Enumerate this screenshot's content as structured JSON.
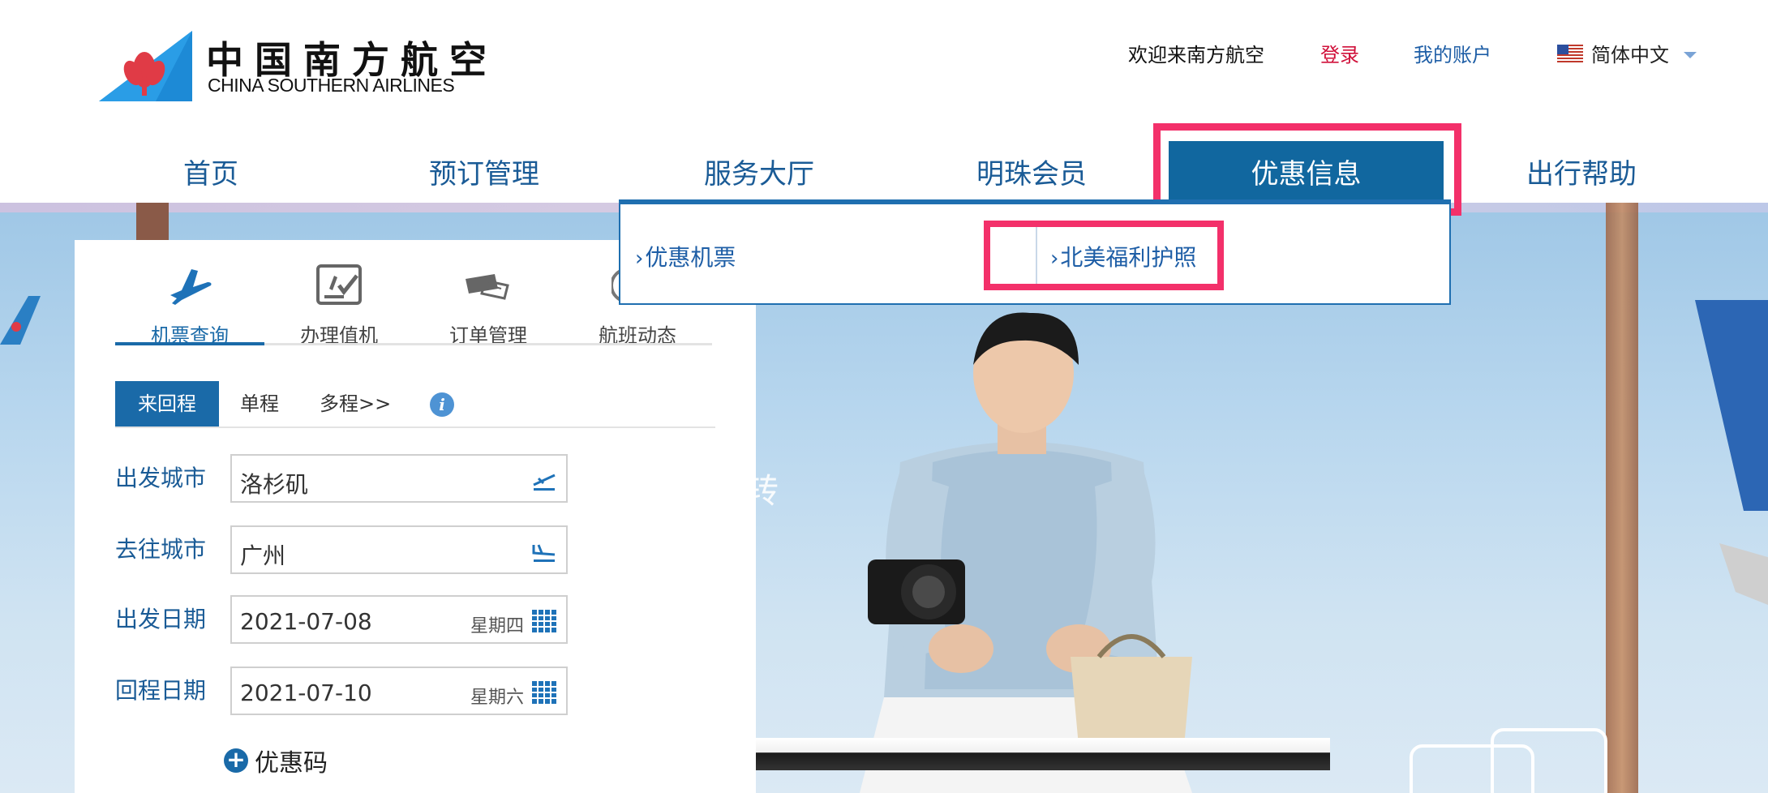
{
  "brand": {
    "name_cn": "中国南方航空",
    "name_en": "CHINA SOUTHERN AIRLINES",
    "colors": {
      "primary": "#11679f",
      "link": "#1e5ea6",
      "login": "#d0103a",
      "highlight": "#f3306a"
    }
  },
  "top_links": {
    "welcome": "欢迎来南方航空",
    "login": "登录",
    "account": "我的账户",
    "language": "简体中文"
  },
  "nav": {
    "items": [
      {
        "label": "首页"
      },
      {
        "label": "预订管理"
      },
      {
        "label": "服务大厅"
      },
      {
        "label": "明珠会员"
      },
      {
        "label": "优惠信息",
        "active": true
      },
      {
        "label": "出行帮助"
      }
    ]
  },
  "dropdown": {
    "items": [
      {
        "chevron": "›",
        "label": "优惠机票"
      },
      {
        "chevron": "›",
        "label": "北美福利护照"
      }
    ]
  },
  "hero": {
    "text": "转"
  },
  "booking": {
    "tabs": [
      {
        "label": "机票查询",
        "icon": "airplane-icon",
        "active": true
      },
      {
        "label": "办理值机",
        "icon": "checkin-icon"
      },
      {
        "label": "订单管理",
        "icon": "ticket-icon"
      },
      {
        "label": "航班动态",
        "icon": "flight-status-icon"
      }
    ],
    "trip_types": {
      "round": "来回程",
      "oneway": "单程",
      "multi": "多程>>"
    },
    "fields": {
      "from": {
        "label": "出发城市",
        "value": "洛杉矶"
      },
      "to": {
        "label": "去往城市",
        "value": "广州"
      },
      "depart": {
        "label": "出发日期",
        "value": "2021-07-08",
        "weekday": "星期四"
      },
      "return": {
        "label": "回程日期",
        "value": "2021-07-10",
        "weekday": "星期六"
      }
    },
    "promo_code": "优惠码"
  }
}
